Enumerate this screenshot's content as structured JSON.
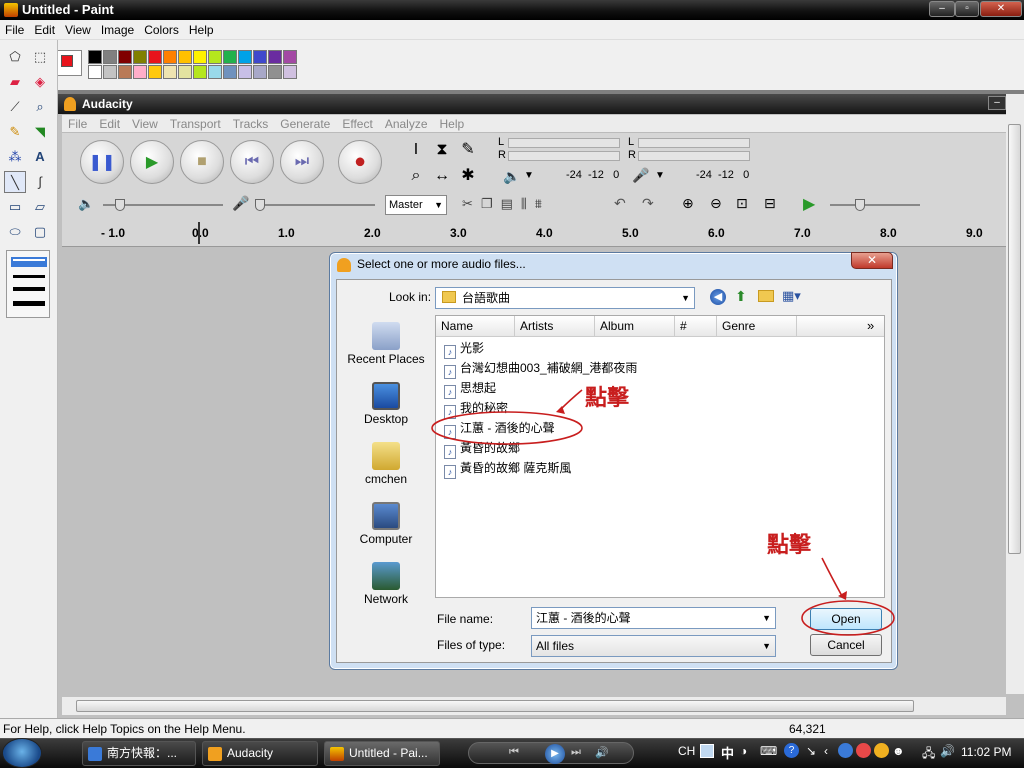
{
  "paint": {
    "title": "Untitled - Paint",
    "menu": [
      "File",
      "Edit",
      "View",
      "Image",
      "Colors",
      "Help"
    ],
    "status_text": "For Help, click Help Topics on the Help Menu.",
    "coords": "64,321",
    "primary_color": "#e8141c",
    "palette_top": [
      "#000000",
      "#808080",
      "#800000",
      "#808000",
      "#e8141c",
      "#ff8000",
      "#ffc000",
      "#fff200",
      "#b5e61d",
      "#22b14c",
      "#00a2e8",
      "#3f48cc",
      "#6a2ca0",
      "#a349a4"
    ],
    "palette_bottom": [
      "#ffffff",
      "#c3c3c3",
      "#b97a57",
      "#ffaec9",
      "#ffc90e",
      "#efe4b0",
      "#e3e3a0",
      "#b5e61d",
      "#99d9ea",
      "#7092be",
      "#c8bfe7",
      "#a8a8c8",
      "#909090",
      "#d0c0e0"
    ]
  },
  "audacity": {
    "title": "Audacity",
    "menu": [
      "File",
      "Edit",
      "View",
      "Transport",
      "Tracks",
      "Generate",
      "Effect",
      "Analyze",
      "Help"
    ],
    "meter_labels": {
      "l": "L",
      "r": "R",
      "db_out": "-24  -12   0",
      "db_in": "-24  -12   0"
    },
    "mixer_source": "Master",
    "ruler": [
      "- 1.0",
      "0.0",
      "1.0",
      "2.0",
      "3.0",
      "4.0",
      "5.0",
      "6.0",
      "7.0",
      "8.0",
      "9.0"
    ]
  },
  "dialog": {
    "title": "Select one or more audio files...",
    "look_in_label": "Look in:",
    "look_in_value": "台語歌曲",
    "places": [
      "Recent Places",
      "Desktop",
      "cmchen",
      "Computer",
      "Network"
    ],
    "columns": [
      "Name",
      "Artists",
      "Album",
      "#",
      "Genre"
    ],
    "more_columns": "»",
    "files": [
      "光影",
      "台灣幻想曲003_補破網_港都夜雨",
      "思想起",
      "我的秘密",
      "江蕙 - 酒後的心聲",
      "黃昏的故鄉",
      "黃昏的故鄉 薩克斯風"
    ],
    "file_name_label": "File name:",
    "file_name_value": "江蕙 - 酒後的心聲",
    "file_type_label": "Files of type:",
    "file_type_value": "All files",
    "open_label": "Open",
    "cancel_label": "Cancel",
    "annotation": "點擊"
  },
  "taskbar": {
    "tasks": [
      "南方快報：...",
      "Audacity",
      "Untitled - Pai..."
    ],
    "lang": "CH",
    "ime": "中",
    "clock": "11:02 PM"
  }
}
